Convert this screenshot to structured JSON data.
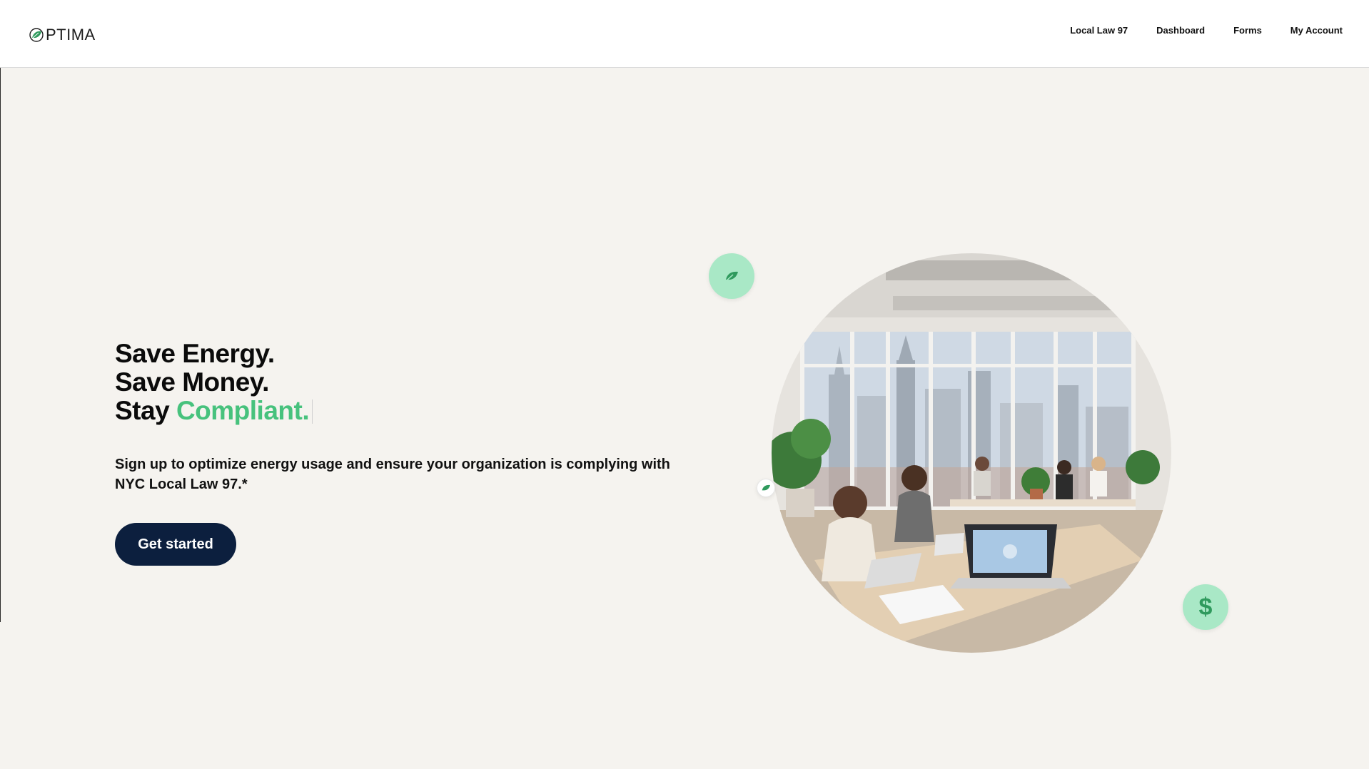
{
  "header": {
    "logo_text": "PTIMA",
    "nav": [
      {
        "label": "Local Law 97"
      },
      {
        "label": "Dashboard"
      },
      {
        "label": "Forms"
      },
      {
        "label": "My Account"
      }
    ]
  },
  "hero": {
    "line1": "Save Energy.",
    "line2": "Save Money.",
    "line3_prefix": "Stay",
    "line3_accent": "Compliant.",
    "subtitle": "Sign up to optimize energy usage and ensure your organization is complying with NYC Local Law 97.*",
    "cta_label": "Get started"
  },
  "illustration": {
    "badge_leaf_icon": "leaf-icon",
    "badge_small_icon": "leaf-icon",
    "badge_dollar_text": "$",
    "badge_dollar_icon": "dollar-icon"
  },
  "colors": {
    "accent_green": "#47c27d",
    "badge_green": "#a9e8c6",
    "cta_navy": "#0c1f3e",
    "background": "#f5f3ef"
  }
}
